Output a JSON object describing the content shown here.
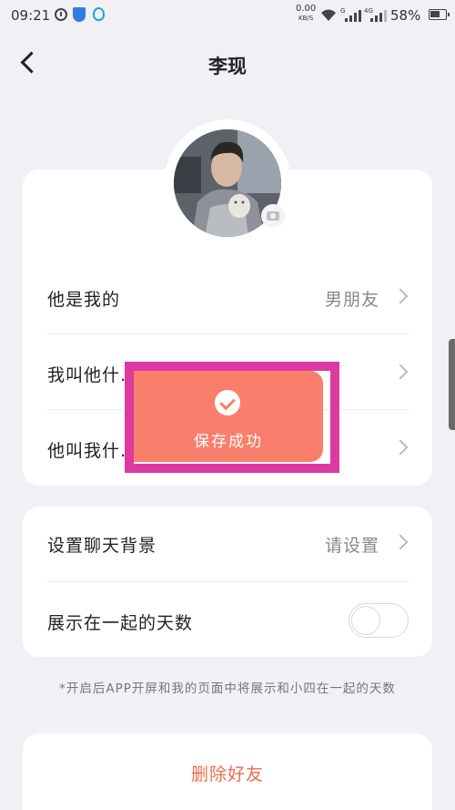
{
  "status_bar": {
    "time": "09:21",
    "net_speed": "0.00",
    "net_unit": "KB/S",
    "sim1_label": "G",
    "sim2_label": "4G",
    "battery": "58%"
  },
  "header": {
    "title": "李现",
    "back_icon": "chevron-left"
  },
  "profile": {
    "avatar_icon": "user-photo",
    "camera_icon": "camera",
    "rows": [
      {
        "label": "他是我的",
        "value": "男朋友"
      },
      {
        "label": "我叫他什…",
        "value": ""
      },
      {
        "label": "他叫我什…",
        "value": ""
      }
    ]
  },
  "settings": {
    "chat_background_label": "设置聊天背景",
    "chat_background_value": "请设置",
    "show_days_label": "展示在一起的天数",
    "show_days_enabled": false
  },
  "note": "*开启后APP开屏和我的页面中将展示和小四在一起的天数",
  "delete_button": "删除好友",
  "toast": {
    "text": "保存成功",
    "icon": "check-circle"
  },
  "colors": {
    "accent": "#ef6c4d",
    "toast": "#f97f6c",
    "highlight": "#dd3aa1",
    "background": "#f1f0f5"
  }
}
